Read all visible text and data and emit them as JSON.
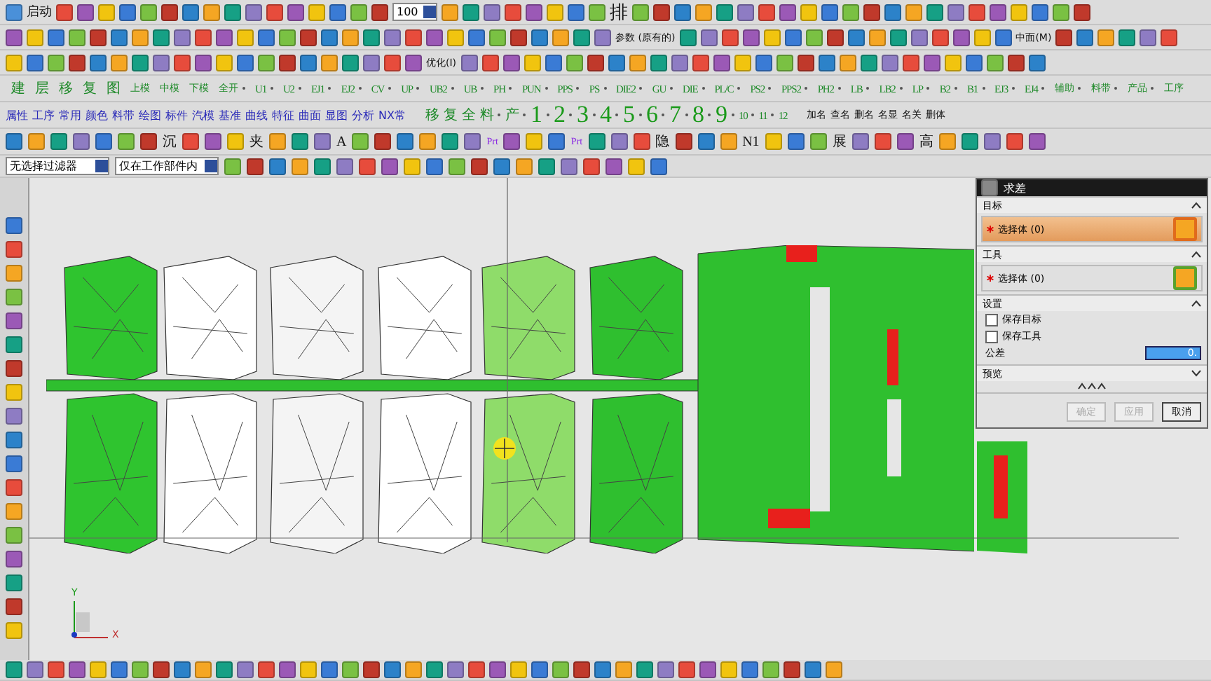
{
  "toolbar_1": {
    "start_label": "启动",
    "zoom_value": "100",
    "sort_label": "排"
  },
  "toolbar_2": {
    "params_label": "参数 (原有的)",
    "midplane_label": "中面(M)"
  },
  "toolbar_3": {
    "optimize_label": "优化(I)"
  },
  "command_bar": [
    {
      "label": "建",
      "kind": "big"
    },
    {
      "label": "层",
      "kind": "big"
    },
    {
      "label": "移",
      "kind": "big"
    },
    {
      "label": "复",
      "kind": "big"
    },
    {
      "label": "图",
      "kind": "big"
    },
    {
      "label": "上模",
      "kind": "small"
    },
    {
      "label": "中模",
      "kind": "small"
    },
    {
      "label": "下模",
      "kind": "small"
    },
    {
      "label": "全开",
      "kind": "small"
    },
    {
      "label": "U1",
      "kind": "code"
    },
    {
      "label": "U2",
      "kind": "code"
    },
    {
      "label": "EJ1",
      "kind": "code"
    },
    {
      "label": "EJ2",
      "kind": "code"
    },
    {
      "label": "CV",
      "kind": "code"
    },
    {
      "label": "UP",
      "kind": "code"
    },
    {
      "label": "UB2",
      "kind": "code"
    },
    {
      "label": "UB",
      "kind": "code"
    },
    {
      "label": "PH",
      "kind": "code"
    },
    {
      "label": "PUN",
      "kind": "code"
    },
    {
      "label": "PPS",
      "kind": "code"
    },
    {
      "label": "PS",
      "kind": "code"
    },
    {
      "label": "DIE2",
      "kind": "code"
    },
    {
      "label": "GU",
      "kind": "code"
    },
    {
      "label": "DIE",
      "kind": "code"
    },
    {
      "label": "PL/C",
      "kind": "code"
    },
    {
      "label": "PS2",
      "kind": "code"
    },
    {
      "label": "PPS2",
      "kind": "code"
    },
    {
      "label": "PH2",
      "kind": "code"
    },
    {
      "label": "LB",
      "kind": "code"
    },
    {
      "label": "LB2",
      "kind": "code"
    },
    {
      "label": "LP",
      "kind": "code"
    },
    {
      "label": "B2",
      "kind": "code"
    },
    {
      "label": "B1",
      "kind": "code"
    },
    {
      "label": "EJ3",
      "kind": "code"
    },
    {
      "label": "EJ4",
      "kind": "code"
    },
    {
      "label": "辅助",
      "kind": "small"
    },
    {
      "label": "料带",
      "kind": "small"
    },
    {
      "label": "产品",
      "kind": "small"
    },
    {
      "label": "工序",
      "kind": "small"
    }
  ],
  "menu_bar": [
    "属性",
    "工序",
    "常用",
    "颜色",
    "料带",
    "绘图",
    "标件",
    "汽模",
    "基准",
    "曲线",
    "特征",
    "曲面",
    "显图",
    "分析",
    "NX常"
  ],
  "quick_bar": [
    {
      "label": "移",
      "kind": "big"
    },
    {
      "label": "复",
      "kind": "big"
    },
    {
      "label": "全",
      "kind": "big"
    },
    {
      "label": "料",
      "kind": "big"
    },
    {
      "label": "产",
      "kind": "big"
    },
    {
      "label": "1",
      "kind": "num"
    },
    {
      "label": "2",
      "kind": "num"
    },
    {
      "label": "3",
      "kind": "num"
    },
    {
      "label": "4",
      "kind": "num"
    },
    {
      "label": "5",
      "kind": "num"
    },
    {
      "label": "6",
      "kind": "num"
    },
    {
      "label": "7",
      "kind": "num"
    },
    {
      "label": "8",
      "kind": "num"
    },
    {
      "label": "9",
      "kind": "num"
    },
    {
      "label": "10",
      "kind": "code"
    },
    {
      "label": "11",
      "kind": "code"
    },
    {
      "label": "12",
      "kind": "code"
    }
  ],
  "name_bar": [
    "加名",
    "查名",
    "删名",
    "名显",
    "名关",
    "删体"
  ],
  "toolbar_6": [
    {
      "label": "沉",
      "kind": "big"
    },
    {
      "label": "夹",
      "kind": "big"
    },
    {
      "label": "A",
      "kind": "big"
    },
    {
      "label": "Prt",
      "kind": "tiny"
    },
    {
      "label": "Prt",
      "kind": "tiny"
    },
    {
      "label": "隐",
      "kind": "big"
    },
    {
      "label": "N1",
      "kind": "big"
    },
    {
      "label": "展",
      "kind": "big"
    },
    {
      "label": "高",
      "kind": "big"
    }
  ],
  "selection_bar": {
    "filter": "无选择过滤器",
    "scope": "仅在工作部件内"
  },
  "axis": {
    "x_label": "X",
    "y_label": "Y"
  },
  "dialog": {
    "title": "求差",
    "sections": [
      {
        "title": "目标",
        "expanded": true,
        "kind": "select",
        "item": "选择体 (0)",
        "selected": true
      },
      {
        "title": "工具",
        "expanded": true,
        "kind": "select",
        "item": "选择体 (0)",
        "selected": false
      },
      {
        "title": "设置",
        "expanded": true,
        "kind": "settings",
        "options": [
          {
            "label": "保存目标",
            "checked": false
          },
          {
            "label": "保存工具",
            "checked": false
          }
        ],
        "tolerance_label": "公差",
        "tolerance_value": "0."
      },
      {
        "title": "预览",
        "expanded": false
      }
    ],
    "buttons": [
      {
        "label": "确定",
        "disabled": true
      },
      {
        "label": "应用",
        "disabled": true
      },
      {
        "label": "取消",
        "disabled": false
      }
    ]
  }
}
